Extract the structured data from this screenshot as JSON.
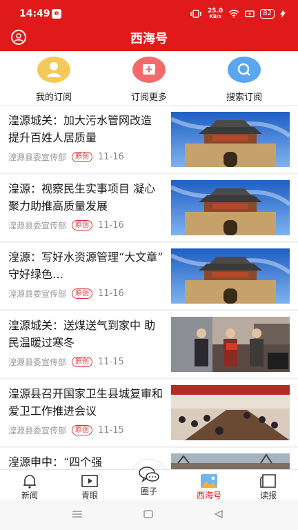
{
  "status": {
    "time": "14:49",
    "app_badge": "e",
    "net_speed_top": "25.0",
    "net_speed_unit": "KB/s",
    "battery": "82"
  },
  "header": {
    "title": "西海号"
  },
  "quick_actions": [
    {
      "label": "我的订阅",
      "icon": "user-icon",
      "color": "#f4c95a"
    },
    {
      "label": "订阅更多",
      "icon": "add-subscription-icon",
      "color": "#f26b6b"
    },
    {
      "label": "搜索订阅",
      "icon": "search-icon",
      "color": "#5aa6f0"
    }
  ],
  "articles": [
    {
      "title": "湟源城关：加大污水管网改造 提升百姓人居质量",
      "source": "湟源县委宣传部",
      "tag": "原创",
      "date": "11-16",
      "thumb": "city-gate-photo"
    },
    {
      "title": "湟源：视察民生实事项目 凝心聚力助推高质量发展",
      "source": "湟源县委宣传部",
      "tag": "原创",
      "date": "11-16",
      "thumb": "city-gate-photo"
    },
    {
      "title": "湟源：写好水资源管理“大文章” 守好绿色…",
      "source": "湟源县委宣传部",
      "tag": "原创",
      "date": "11-16",
      "thumb": "city-gate-photo"
    },
    {
      "title": "湟源城关：送煤送气到家中 助民温暖过寒冬",
      "source": "湟源县委宣传部",
      "tag": "原创",
      "date": "11-15",
      "thumb": "people-photo"
    },
    {
      "title": "湟源县召开国家卫生县城复审和爱卫工作推进会议",
      "source": "湟源县委宣传部",
      "tag": "原创",
      "date": "11-15",
      "thumb": "meeting-photo"
    },
    {
      "title": "湟源申中：“四个强",
      "source": "",
      "tag": "",
      "date": "",
      "thumb": "outdoor-photo"
    }
  ],
  "tabs": [
    {
      "label": "新闻",
      "icon": "bell-icon"
    },
    {
      "label": "青眼",
      "icon": "tv-icon"
    },
    {
      "label": "圈子",
      "icon": "chat-icon"
    },
    {
      "label": "西海号",
      "icon": "gallery-icon"
    },
    {
      "label": "读报",
      "icon": "newspaper-icon"
    }
  ],
  "colors": {
    "brand_red": "#e01a1a"
  }
}
